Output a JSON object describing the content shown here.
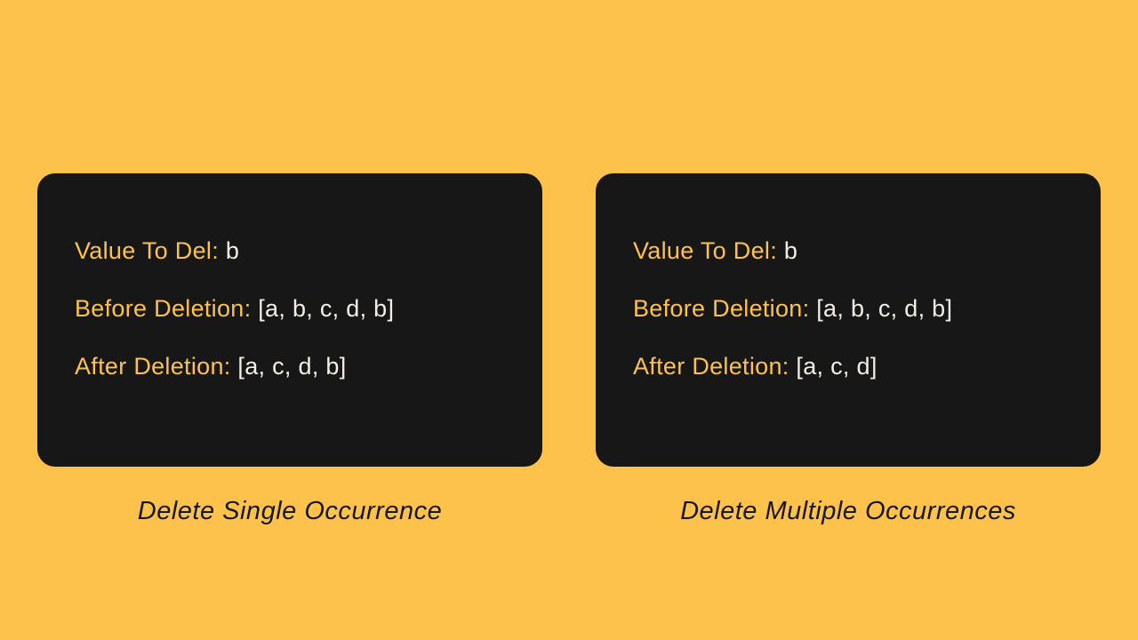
{
  "panels": [
    {
      "caption": "Delete Single Occurrence",
      "rows": [
        {
          "label": "Value To Del: ",
          "value": "b"
        },
        {
          "label": "Before Deletion: ",
          "value": "[a, b, c, d, b]"
        },
        {
          "label": "After Deletion: ",
          "value": "[a, c, d, b]"
        }
      ]
    },
    {
      "caption": "Delete Multiple Occurrences",
      "rows": [
        {
          "label": "Value To Del: ",
          "value": "b"
        },
        {
          "label": "Before Deletion: ",
          "value": "[a, b, c, d, b]"
        },
        {
          "label": "After Deletion: ",
          "value": "[a, c, d]"
        }
      ]
    }
  ]
}
